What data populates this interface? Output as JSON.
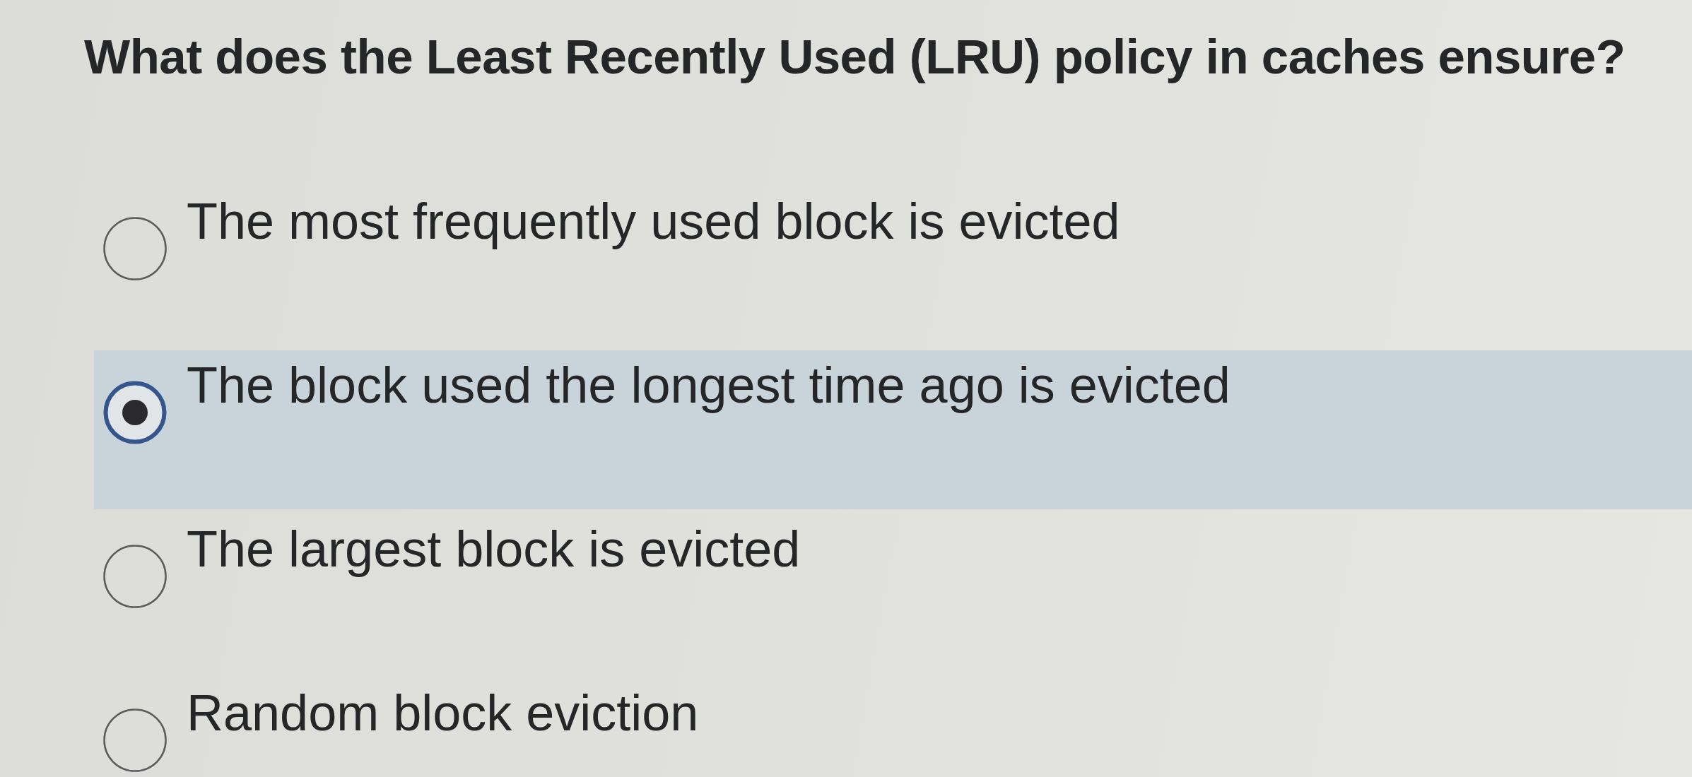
{
  "question": "What does the Least Recently Used (LRU) policy in caches ensure?",
  "options": [
    {
      "label": "The most frequently used block is evicted",
      "selected": false
    },
    {
      "label": "The block used the longest time ago is evicted",
      "selected": true
    },
    {
      "label": "The largest block is evicted",
      "selected": false
    },
    {
      "label": "Random block eviction",
      "selected": false
    }
  ]
}
